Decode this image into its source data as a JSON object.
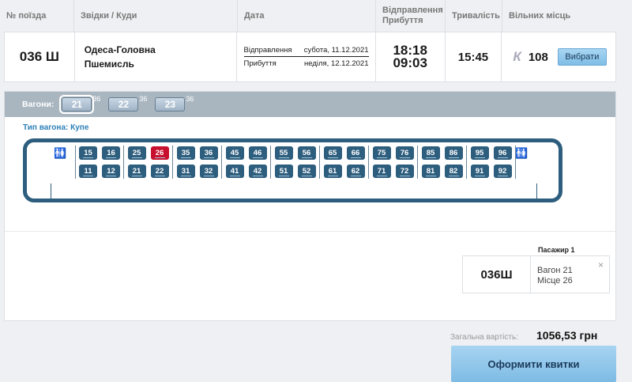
{
  "table": {
    "headers": {
      "train": "№ поїзда",
      "route": "Звідки / Куди",
      "date": "Дата",
      "depart_arrive_1": "Відправлення",
      "depart_arrive_2": "Прибуття",
      "duration": "Тривалість",
      "free_seats": "Вільних місць"
    },
    "row": {
      "train_number": "036 Ш",
      "from": "Одеса-Головна",
      "to": "Пшемисль",
      "departure_label": "Відправлення",
      "departure_date": "субота, 11.12.2021",
      "arrival_label": "Прибуття",
      "arrival_date": "неділя, 12.12.2021",
      "departure_time": "18:18",
      "arrival_time": "09:03",
      "duration": "15:45",
      "class_letter": "К",
      "seats_count": "108",
      "choose_label": "Вибрати"
    }
  },
  "wagons": {
    "label": "Вагони:",
    "items": [
      {
        "number": "21",
        "free": "36",
        "active": true
      },
      {
        "number": "22",
        "free": "36",
        "active": false
      },
      {
        "number": "23",
        "free": "36",
        "active": false
      }
    ],
    "type_label": "Тип вагона: Купе"
  },
  "layout": {
    "compartments": [
      {
        "top": [
          "15",
          "16"
        ],
        "bottom": [
          "11",
          "12"
        ]
      },
      {
        "top": [
          "25",
          "26"
        ],
        "bottom": [
          "21",
          "22"
        ]
      },
      {
        "top": [
          "35",
          "36"
        ],
        "bottom": [
          "31",
          "32"
        ]
      },
      {
        "top": [
          "45",
          "46"
        ],
        "bottom": [
          "41",
          "42"
        ]
      },
      {
        "top": [
          "55",
          "56"
        ],
        "bottom": [
          "51",
          "52"
        ]
      },
      {
        "top": [
          "65",
          "66"
        ],
        "bottom": [
          "61",
          "62"
        ]
      },
      {
        "top": [
          "75",
          "76"
        ],
        "bottom": [
          "71",
          "72"
        ]
      },
      {
        "top": [
          "85",
          "86"
        ],
        "bottom": [
          "81",
          "82"
        ]
      },
      {
        "top": [
          "95",
          "96"
        ],
        "bottom": [
          "91",
          "92"
        ]
      }
    ],
    "selected_seat": "26",
    "wc_icon": "restroom-icon"
  },
  "passenger": {
    "label": "Пасажир 1",
    "train": "036Ш",
    "wagon": "Вагон 21",
    "seat": "Місце 26",
    "close_glyph": "×"
  },
  "summary": {
    "total_label": "Загальна вартість:",
    "total_value": "1056,53 грн",
    "checkout_label": "Оформити квитки"
  },
  "colors": {
    "seat": "#2e5e7e",
    "seat_selected": "#c8102e",
    "accent": "#2c7fb8",
    "button": "#8cc6ea"
  }
}
